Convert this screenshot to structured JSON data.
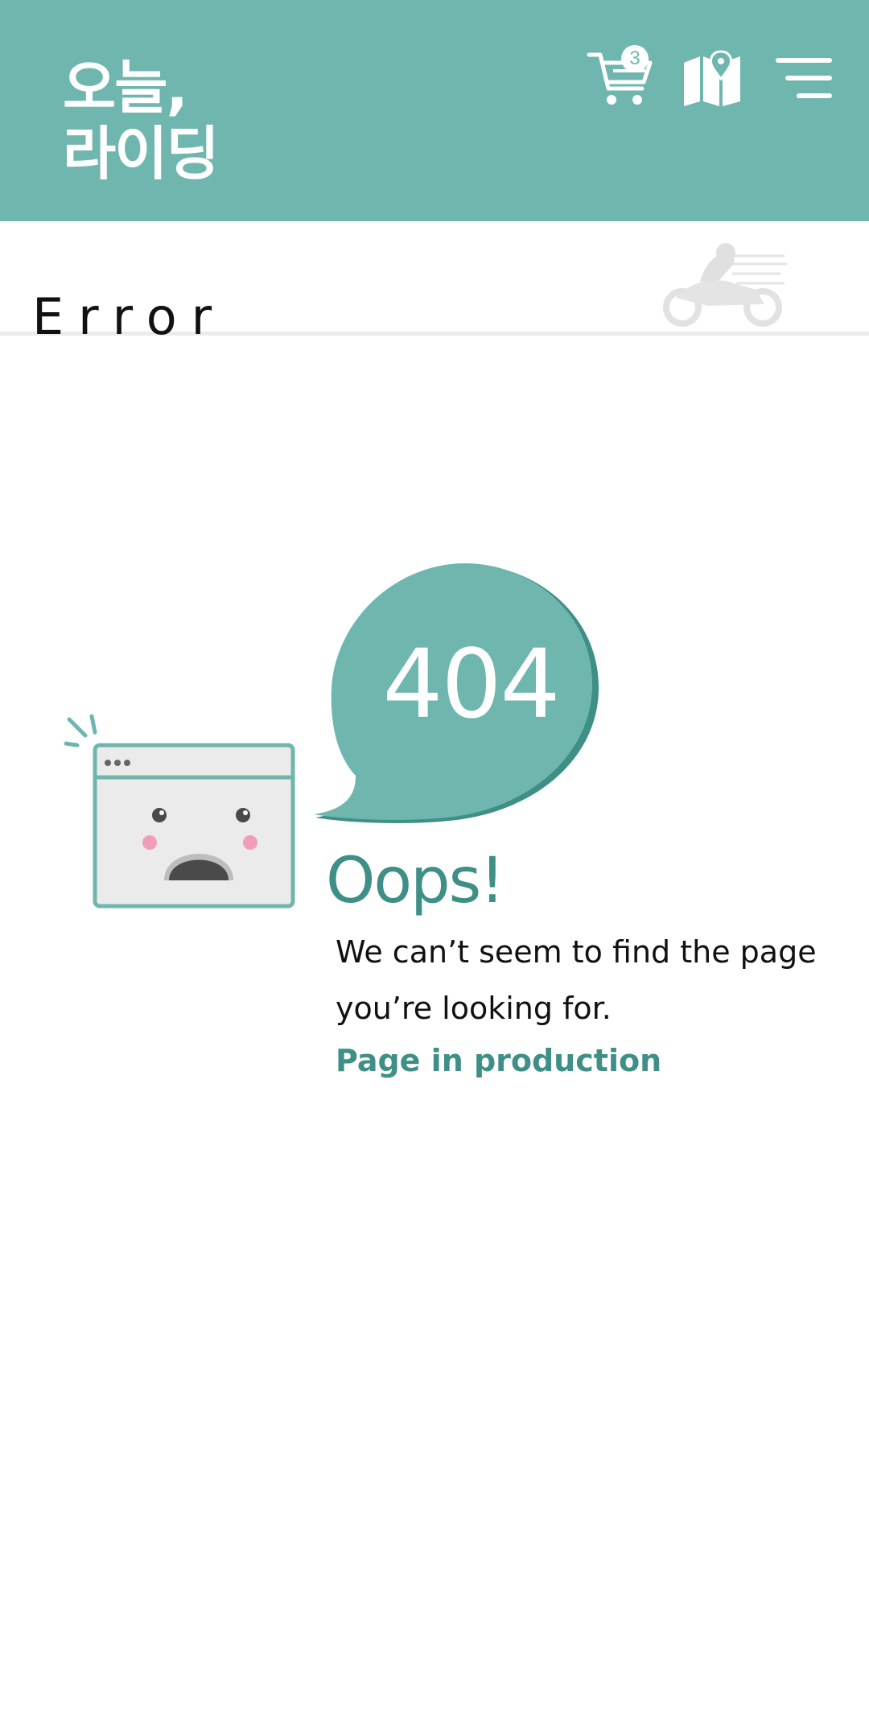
{
  "header": {
    "logo_line1": "오늘,",
    "logo_line2": "라이딩",
    "cart_count": "3",
    "icons": [
      "cart-icon",
      "map-icon",
      "menu-icon"
    ],
    "background_color": "#6fb7ae"
  },
  "page": {
    "title": "Error"
  },
  "error": {
    "code": "404",
    "headline": "Oops!",
    "message": "We can’t seem to find the page you’re looking for.",
    "link_label": "Page in production",
    "accent_color": "#3e8f86"
  }
}
